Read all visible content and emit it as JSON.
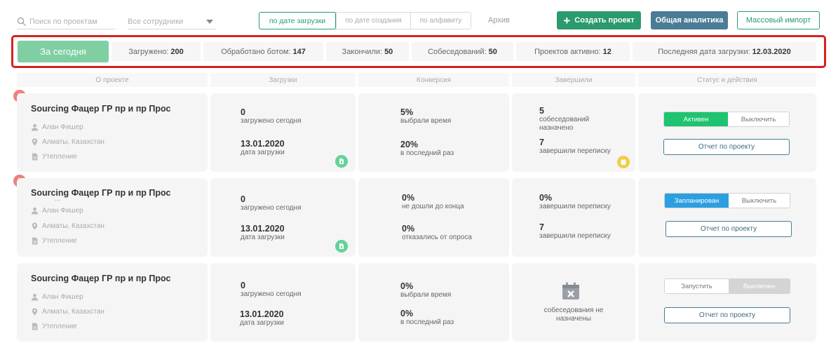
{
  "toolbar": {
    "search_placeholder": "Поиск по проектам",
    "employee_select": "Все сотрудники",
    "sort_options": [
      "по дате загрузки",
      "по дате создания",
      "по алфавиту"
    ],
    "archive": "Архив",
    "create_label": "Создать проект",
    "analytics_label": "Общая аналитика",
    "import_label": "Массовый импорт"
  },
  "summary": {
    "today": "За сегодня",
    "stats": [
      {
        "label": "Загружено:",
        "value": "200"
      },
      {
        "label": "Обработано ботом:",
        "value": "147"
      },
      {
        "label": "Закончили:",
        "value": "50"
      },
      {
        "label": "Собеседований:",
        "value": "50"
      },
      {
        "label": "Проектов активно:",
        "value": "12"
      },
      {
        "label": "Последняя дата загрузки:",
        "value": "12.03.2020"
      }
    ]
  },
  "columns": [
    "О проекте",
    "Загрузки",
    "Конверсия",
    "Завершили",
    "Статус и действия"
  ],
  "projects": [
    {
      "title": "Sourcing Фацер ГР пр и пр Прос",
      "title_extra": "",
      "owner": "Алан Фишер",
      "location": "Алматы, Казахстан",
      "tag": "Утепление",
      "loaded_today": "0",
      "loaded_today_label": "загружено сегодня",
      "load_date": "13.01.2020",
      "load_date_label": "дата загрузки",
      "conv1": "5%",
      "conv1_label": "выбрали время",
      "conv2": "20%",
      "conv2_label": "в последний раз",
      "done1": "5",
      "done1_label": "собеседований назначено",
      "done2": "7",
      "done2_label": "завершили переписку",
      "status_on": "Активен",
      "status_off": "Выключить",
      "report": "Отчет по проекту"
    },
    {
      "title": "Sourcing Фацер ГР пр и пр Прос",
      "title_extra": "...",
      "owner": "Алан Фишер",
      "location": "Алматы, Казахстан",
      "tag": "Утепление",
      "loaded_today": "0",
      "loaded_today_label": "загружено сегодня",
      "load_date": "13.01.2020",
      "load_date_label": "дата загрузки",
      "conv1": "0%",
      "conv1_label": "не дошли до конца",
      "conv2": "0%",
      "conv2_label": "отказались от опроса",
      "done1": "0%",
      "done1_label": "завершили переписку",
      "done2": "7",
      "done2_label": "завершили переписку",
      "status_on": "Запланирован",
      "status_off": "Выключить",
      "report": "Отчет по проекту"
    },
    {
      "title": "Sourcing Фацер ГР пр и пр Прос",
      "title_extra": "",
      "owner": "Алан Фишер",
      "location": "Алматы, Казахстан",
      "tag": "Утепление",
      "loaded_today": "0",
      "loaded_today_label": "загружено сегодня",
      "load_date": "13.01.2020",
      "load_date_label": "дата загрузки",
      "conv1": "0%",
      "conv1_label": "выбрали время",
      "conv2": "0%",
      "conv2_label": "в последний раз",
      "no_interviews": "собеседования не назначены",
      "status_on": "Запустить",
      "status_off": "Выключен",
      "report": "Отчет по проекту"
    }
  ],
  "colors": {
    "green": "#2b9a6c",
    "active": "#1fc36f",
    "planned": "#2c9fe0",
    "alert": "#ef8080"
  }
}
